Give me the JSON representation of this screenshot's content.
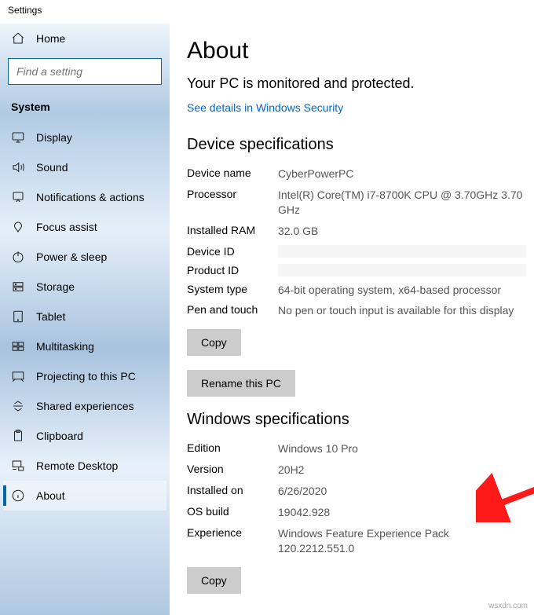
{
  "titlebar": "Settings",
  "sidebar": {
    "home": "Home",
    "search_placeholder": "Find a setting",
    "section": "System",
    "items": [
      {
        "label": "Display"
      },
      {
        "label": "Sound"
      },
      {
        "label": "Notifications & actions"
      },
      {
        "label": "Focus assist"
      },
      {
        "label": "Power & sleep"
      },
      {
        "label": "Storage"
      },
      {
        "label": "Tablet"
      },
      {
        "label": "Multitasking"
      },
      {
        "label": "Projecting to this PC"
      },
      {
        "label": "Shared experiences"
      },
      {
        "label": "Clipboard"
      },
      {
        "label": "Remote Desktop"
      },
      {
        "label": "About"
      }
    ]
  },
  "main": {
    "title": "About",
    "subtitle": "Your PC is monitored and protected.",
    "security_link": "See details in Windows Security",
    "device_spec_heading": "Device specifications",
    "device_specs": {
      "device_name_label": "Device name",
      "device_name": "CyberPowerPC",
      "processor_label": "Processor",
      "processor": "Intel(R) Core(TM) i7-8700K CPU @ 3.70GHz   3.70 GHz",
      "ram_label": "Installed RAM",
      "ram": "32.0 GB",
      "device_id_label": "Device ID",
      "product_id_label": "Product ID",
      "system_type_label": "System type",
      "system_type": "64-bit operating system, x64-based processor",
      "pen_label": "Pen and touch",
      "pen": "No pen or touch input is available for this display",
      "copy_btn": "Copy"
    },
    "rename_btn": "Rename this PC",
    "win_spec_heading": "Windows specifications",
    "win_specs": {
      "edition_label": "Edition",
      "edition": "Windows 10 Pro",
      "version_label": "Version",
      "version": "20H2",
      "installed_label": "Installed on",
      "installed": "6/26/2020",
      "build_label": "OS build",
      "build": "19042.928",
      "experience_label": "Experience",
      "experience": "Windows Feature Experience Pack 120.2212.551.0",
      "copy_btn": "Copy"
    }
  },
  "watermark": "wsxdn.com"
}
